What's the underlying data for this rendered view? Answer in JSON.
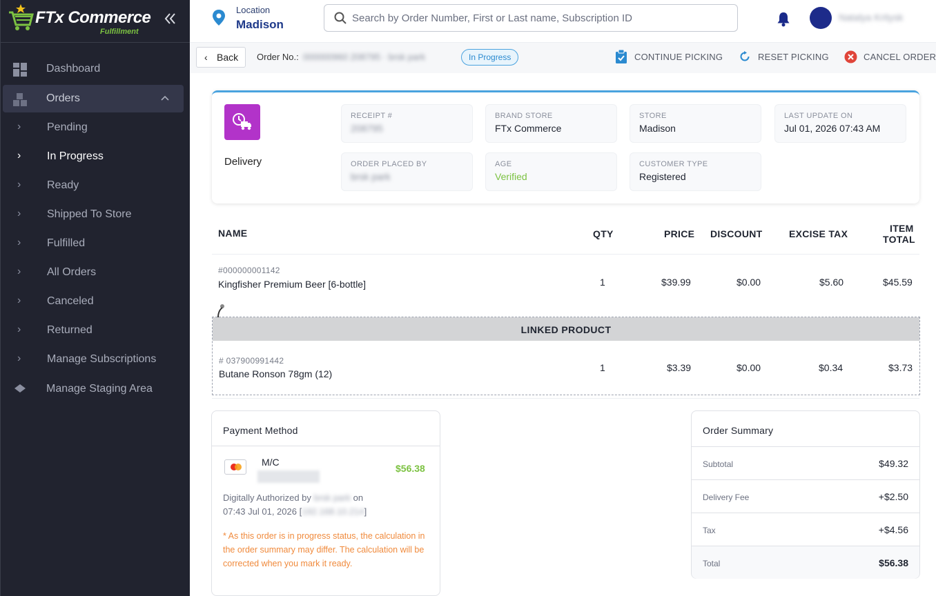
{
  "brand": {
    "name": "FTx Commerce",
    "subtitle": "Fulfillment"
  },
  "sidebar": {
    "items": [
      {
        "label": "Dashboard"
      },
      {
        "label": "Orders"
      },
      {
        "label": "Pending"
      },
      {
        "label": "In Progress"
      },
      {
        "label": "Ready"
      },
      {
        "label": "Shipped To Store"
      },
      {
        "label": "Fulfilled"
      },
      {
        "label": "All Orders"
      },
      {
        "label": "Canceled"
      },
      {
        "label": "Returned"
      },
      {
        "label": "Manage Subscriptions"
      },
      {
        "label": "Manage Staging Area"
      }
    ]
  },
  "header": {
    "location_label": "Location",
    "location_value": "Madison",
    "search_placeholder": "Search by Order Number, First or Last name, Subscription ID",
    "user_name": "Natalya Kritysk"
  },
  "subheader": {
    "back_label": "Back",
    "order_no_label": "Order No.:",
    "order_no_value": "000000960 208795 · brsk park",
    "status": "In Progress",
    "actions": {
      "continue": "CONTINUE PICKING",
      "reset": "RESET PICKING",
      "cancel": "CANCEL ORDER"
    }
  },
  "order_info": {
    "delivery_label": "Delivery",
    "fields": {
      "receipt": {
        "label": "RECEIPT #",
        "value": "208795"
      },
      "brand_store": {
        "label": "BRAND STORE",
        "value": "FTx Commerce"
      },
      "store": {
        "label": "STORE",
        "value": "Madison"
      },
      "last_update": {
        "label": "LAST UPDATE ON",
        "value": "Jul 01, 2026 07:43 AM"
      },
      "placed_by": {
        "label": "ORDER PLACED BY",
        "value": "brsk park"
      },
      "age": {
        "label": "AGE",
        "value": "Verified"
      },
      "customer_type": {
        "label": "CUSTOMER TYPE",
        "value": "Registered"
      }
    }
  },
  "items_table": {
    "headers": {
      "name": "NAME",
      "qty": "QTY",
      "price": "PRICE",
      "discount": "DISCOUNT",
      "excise": "EXCISE TAX",
      "total_line1": "ITEM",
      "total_line2": "TOTAL"
    },
    "rows": [
      {
        "sku": "#000000001142",
        "name": "Kingfisher Premium Beer [6-bottle]",
        "qty": "1",
        "price": "$39.99",
        "discount": "$0.00",
        "excise": "$5.60",
        "total": "$45.59"
      }
    ],
    "linked_title": "LINKED PRODUCT",
    "linked_rows": [
      {
        "sku": "# 037900991442",
        "name": "Butane Ronson 78gm (12)",
        "qty": "1",
        "price": "$3.39",
        "discount": "$0.00",
        "excise": "$0.34",
        "total": "$3.73"
      }
    ]
  },
  "payment": {
    "title": "Payment Method",
    "card_type": "M/C",
    "amount": "$56.38",
    "auth_prefix": "Digitally Authorized by",
    "auth_name": "brsk park",
    "auth_on": "on",
    "auth_time": "07:43 Jul 01, 2026 [",
    "auth_ip": "192.168.10.214",
    "auth_close": "]",
    "note": "* As this order is in progress status, the calculation in the order summary may differ. The calculation will be corrected when you mark it ready."
  },
  "summary": {
    "title": "Order Summary",
    "rows": [
      {
        "label": "Subtotal",
        "value": "$49.32"
      },
      {
        "label": "Delivery Fee",
        "value": "+$2.50"
      },
      {
        "label": "Tax",
        "value": "+$4.56"
      },
      {
        "label": "Total",
        "value": "$56.38"
      }
    ]
  },
  "colors": {
    "sidebar_bg": "#21232f",
    "accent_blue": "#4aa3df",
    "delivery_purple": "#b233c9",
    "green": "#7cc242",
    "note_orange": "#f08a3c",
    "cancel_red": "#e0453a"
  },
  "icons": [
    "cart-logo-icon",
    "double-chevron-left-icon",
    "dashboard-icon",
    "orders-icon",
    "chevron-right-icon",
    "staging-icon",
    "location-pin-icon",
    "search-icon",
    "bell-icon",
    "clipboard-check-icon",
    "refresh-icon",
    "cancel-circle-icon",
    "delivery-truck-icon",
    "mastercard-icon"
  ]
}
